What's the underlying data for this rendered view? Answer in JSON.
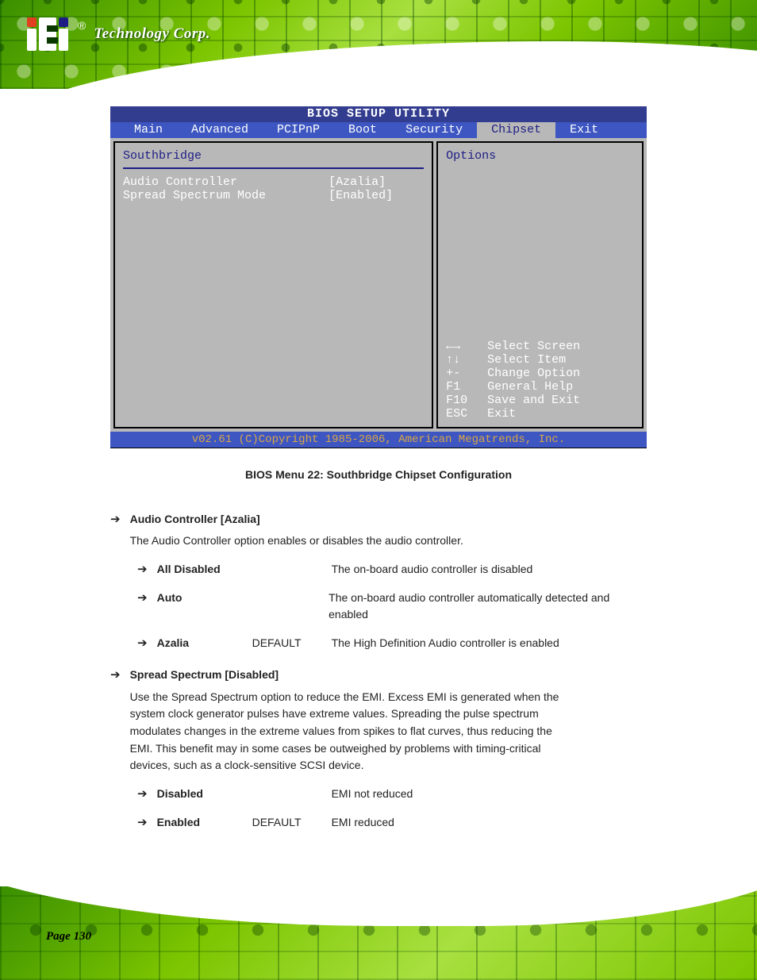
{
  "brand": {
    "text": "Technology Corp."
  },
  "bios": {
    "title": "BIOS SETUP UTILITY",
    "tabs": [
      "Main",
      "Advanced",
      "PCIPnP",
      "Boot",
      "Security",
      "Chipset",
      "Exit"
    ],
    "activeTab": "Chipset",
    "left": {
      "heading": "Southbridge",
      "rows": [
        {
          "label": "Audio Controller",
          "value": "[Azalia]"
        },
        {
          "label": "Spread Spectrum Mode",
          "value": "[Enabled]"
        }
      ]
    },
    "right": {
      "heading": "Options",
      "help": [
        {
          "key": "←→",
          "text": "Select Screen"
        },
        {
          "key": "↑↓",
          "text": "Select Item"
        },
        {
          "key": "+-",
          "text": "Change Option"
        },
        {
          "key": "F1",
          "text": "General Help"
        },
        {
          "key": "F10",
          "text": "Save and Exit"
        },
        {
          "key": "ESC",
          "text": "Exit"
        }
      ]
    },
    "footer": "v02.61 (C)Copyright 1985-2006, American Megatrends, Inc."
  },
  "doc": {
    "caption": "BIOS Menu 22: Southbridge Chipset Configuration",
    "section1": {
      "head": "Audio Controller [Azalia]",
      "desc": "The Audio Controller option enables or disables the audio controller.",
      "opts": [
        {
          "name": "All Disabled",
          "text": "The on-board audio controller is disabled"
        },
        {
          "name": "Auto",
          "text": "The on-board audio controller automatically detected and enabled"
        },
        {
          "name": "Azalia",
          "default": "DEFAULT",
          "text": "The High Definition Audio controller is enabled"
        }
      ]
    },
    "section2": {
      "head": "Spread Spectrum [Disabled]",
      "desc": "Use the Spread Spectrum option to reduce the EMI. Excess EMI is generated when the system clock generator pulses have extreme values. Spreading the pulse spectrum modulates changes in the extreme values from spikes to flat curves, thus reducing the EMI. This benefit may in some cases be outweighed by problems with timing-critical devices, such as a clock-sensitive SCSI device.",
      "opts": [
        {
          "name": "Disabled",
          "text": "EMI not reduced"
        },
        {
          "name": "Enabled",
          "default": "DEFAULT",
          "text": "EMI reduced"
        }
      ]
    }
  },
  "pageNumber": "Page 130"
}
